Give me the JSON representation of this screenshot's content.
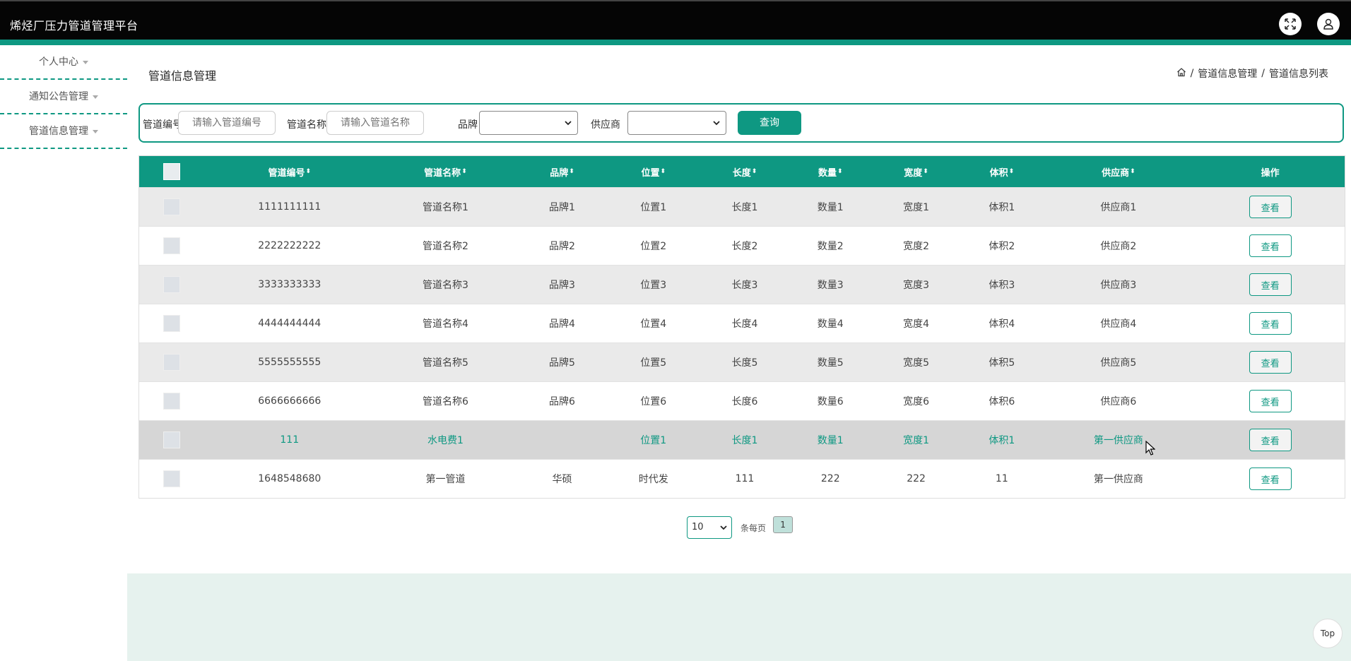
{
  "app": {
    "title": "烯烃厂压力管道管理平台",
    "colors": {
      "accent": "#0e9882",
      "topbar": "#050505",
      "row_alt": "#eaeaea",
      "row_highlight": "#d6d6d6"
    }
  },
  "header": {
    "fullscreen_icon": "expand-icon",
    "user_icon": "user-icon"
  },
  "sidebar": {
    "items": [
      {
        "label": "个人中心"
      },
      {
        "label": "通知公告管理"
      },
      {
        "label": "管道信息管理"
      }
    ]
  },
  "page": {
    "title": "管道信息管理",
    "breadcrumb": {
      "home_icon": "home-icon",
      "sep": "/",
      "level1": "管道信息管理",
      "level2": "管道信息列表"
    }
  },
  "search": {
    "code_label": "管道编号",
    "code_placeholder": "请输入管道编号",
    "name_label": "管道名称",
    "name_placeholder": "请输入管道名称",
    "brand_label": "品牌",
    "brand_value": "",
    "supplier_label": "供应商",
    "supplier_value": "",
    "query_label": "查询"
  },
  "table": {
    "headers": {
      "code": "管道编号",
      "name": "管道名称",
      "brand": "品牌",
      "location": "位置",
      "length": "长度",
      "quantity": "数量",
      "width": "宽度",
      "volume": "体积",
      "supplier": "供应商",
      "actions": "操作",
      "sort_glyph": "⬍"
    },
    "view_label": "查看",
    "rows": [
      {
        "code": "1111111111",
        "name": "管道名称1",
        "brand": "品牌1",
        "location": "位置1",
        "length": "长度1",
        "quantity": "数量1",
        "width": "宽度1",
        "volume": "体积1",
        "supplier": "供应商1"
      },
      {
        "code": "2222222222",
        "name": "管道名称2",
        "brand": "品牌2",
        "location": "位置2",
        "length": "长度2",
        "quantity": "数量2",
        "width": "宽度2",
        "volume": "体积2",
        "supplier": "供应商2"
      },
      {
        "code": "3333333333",
        "name": "管道名称3",
        "brand": "品牌3",
        "location": "位置3",
        "length": "长度3",
        "quantity": "数量3",
        "width": "宽度3",
        "volume": "体积3",
        "supplier": "供应商3"
      },
      {
        "code": "4444444444",
        "name": "管道名称4",
        "brand": "品牌4",
        "location": "位置4",
        "length": "长度4",
        "quantity": "数量4",
        "width": "宽度4",
        "volume": "体积4",
        "supplier": "供应商4"
      },
      {
        "code": "5555555555",
        "name": "管道名称5",
        "brand": "品牌5",
        "location": "位置5",
        "length": "长度5",
        "quantity": "数量5",
        "width": "宽度5",
        "volume": "体积5",
        "supplier": "供应商5"
      },
      {
        "code": "6666666666",
        "name": "管道名称6",
        "brand": "品牌6",
        "location": "位置6",
        "length": "长度6",
        "quantity": "数量6",
        "width": "宽度6",
        "volume": "体积6",
        "supplier": "供应商6"
      },
      {
        "code": "111",
        "name": "水电费1",
        "brand": "",
        "location": "位置1",
        "length": "长度1",
        "quantity": "数量1",
        "width": "宽度1",
        "volume": "体积1",
        "supplier": "第一供应商"
      },
      {
        "code": "1648548680",
        "name": "第一管道",
        "brand": "华硕",
        "location": "时代发",
        "length": "111",
        "quantity": "222",
        "width": "222",
        "volume": "11",
        "supplier": "第一供应商"
      }
    ]
  },
  "pagination": {
    "page_size": "10",
    "per_page_label": "条每页",
    "current_page": "1"
  },
  "misc": {
    "top_label": "Top"
  }
}
